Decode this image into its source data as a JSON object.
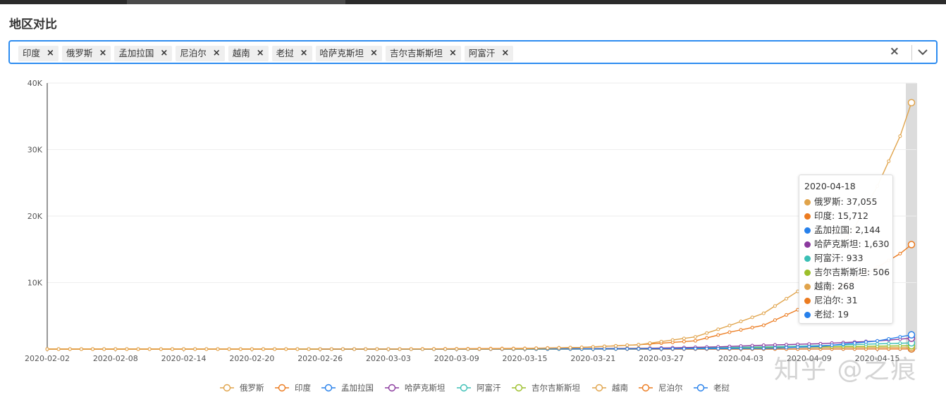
{
  "title": "地区对比",
  "selector": {
    "tags": [
      "印度",
      "俄罗斯",
      "孟加拉国",
      "尼泊尔",
      "越南",
      "老挝",
      "哈萨克斯坦",
      "吉尔吉斯斯坦",
      "阿富汗"
    ],
    "remove_glyph": "×",
    "clear_glyph": "×"
  },
  "tooltip": {
    "date": "2020-04-18",
    "rows": [
      {
        "label": "俄罗斯: 37,055",
        "color": "#e0a34a"
      },
      {
        "label": "印度: 15,712",
        "color": "#ec7b1f"
      },
      {
        "label": "孟加拉国: 2,144",
        "color": "#2680eb"
      },
      {
        "label": "哈萨克斯坦: 1,630",
        "color": "#8b3a9e"
      },
      {
        "label": "阿富汗: 933",
        "color": "#3bbfb5"
      },
      {
        "label": "吉尔吉斯斯坦: 506",
        "color": "#9cbf2a"
      },
      {
        "label": "越南: 268",
        "color": "#e0a34a"
      },
      {
        "label": "尼泊尔: 31",
        "color": "#ec7b1f"
      },
      {
        "label": "老挝: 19",
        "color": "#2680eb"
      }
    ]
  },
  "watermark": "知乎 @之痕",
  "chart_data": {
    "type": "line",
    "x_start": "2020-02-02",
    "x_end": "2020-04-18",
    "x_tick_labels": [
      "2020-02-02",
      "2020-02-08",
      "2020-02-14",
      "2020-02-20",
      "2020-02-26",
      "2020-03-03",
      "2020-03-09",
      "2020-03-15",
      "2020-03-21",
      "2020-03-27",
      "2020-04-03",
      "2020-04-09",
      "2020-04-15"
    ],
    "y_tick_labels": [
      "10K",
      "20K",
      "30K",
      "40K"
    ],
    "ylim": [
      0,
      40000
    ],
    "grid": true,
    "legend_position": "bottom",
    "highlighted_date": "2020-04-18",
    "series": [
      {
        "name": "俄罗斯",
        "color": "#e0a34a",
        "points": [
          [
            "2020-02-02",
            2
          ],
          [
            "2020-03-01",
            2
          ],
          [
            "2020-03-10",
            10
          ],
          [
            "2020-03-15",
            63
          ],
          [
            "2020-03-20",
            253
          ],
          [
            "2020-03-25",
            658
          ],
          [
            "2020-03-30",
            1836
          ],
          [
            "2020-04-02",
            3548
          ],
          [
            "2020-04-05",
            5389
          ],
          [
            "2020-04-08",
            8672
          ],
          [
            "2020-04-10",
            11917
          ],
          [
            "2020-04-13",
            18328
          ],
          [
            "2020-04-15",
            24490
          ],
          [
            "2020-04-17",
            32008
          ],
          [
            "2020-04-18",
            37055
          ]
        ]
      },
      {
        "name": "印度",
        "color": "#ec7b1f",
        "points": [
          [
            "2020-02-02",
            2
          ],
          [
            "2020-03-03",
            6
          ],
          [
            "2020-03-10",
            50
          ],
          [
            "2020-03-15",
            110
          ],
          [
            "2020-03-20",
            250
          ],
          [
            "2020-03-25",
            657
          ],
          [
            "2020-03-30",
            1251
          ],
          [
            "2020-04-02",
            2543
          ],
          [
            "2020-04-05",
            3588
          ],
          [
            "2020-04-08",
            5916
          ],
          [
            "2020-04-10",
            7598
          ],
          [
            "2020-04-13",
            10453
          ],
          [
            "2020-04-15",
            12322
          ],
          [
            "2020-04-17",
            14352
          ],
          [
            "2020-04-18",
            15712
          ]
        ]
      },
      {
        "name": "孟加拉国",
        "color": "#2680eb",
        "points": [
          [
            "2020-02-26",
            0
          ],
          [
            "2020-03-08",
            3
          ],
          [
            "2020-03-25",
            39
          ],
          [
            "2020-04-05",
            88
          ],
          [
            "2020-04-10",
            424
          ],
          [
            "2020-04-15",
            1231
          ],
          [
            "2020-04-18",
            2144
          ]
        ]
      },
      {
        "name": "哈萨克斯坦",
        "color": "#8b3a9e",
        "points": [
          [
            "2020-02-26",
            0
          ],
          [
            "2020-03-13",
            6
          ],
          [
            "2020-03-25",
            81
          ],
          [
            "2020-04-01",
            343
          ],
          [
            "2020-04-05",
            584
          ],
          [
            "2020-04-10",
            812
          ],
          [
            "2020-04-15",
            1232
          ],
          [
            "2020-04-18",
            1630
          ]
        ]
      },
      {
        "name": "阿富汗",
        "color": "#3bbfb5",
        "points": [
          [
            "2020-02-24",
            1
          ],
          [
            "2020-03-10",
            5
          ],
          [
            "2020-03-25",
            84
          ],
          [
            "2020-04-01",
            196
          ],
          [
            "2020-04-05",
            337
          ],
          [
            "2020-04-10",
            521
          ],
          [
            "2020-04-15",
            784
          ],
          [
            "2020-04-18",
            933
          ]
        ]
      },
      {
        "name": "吉尔吉斯斯坦",
        "color": "#9cbf2a",
        "points": [
          [
            "2020-02-26",
            0
          ],
          [
            "2020-03-18",
            3
          ],
          [
            "2020-03-25",
            44
          ],
          [
            "2020-04-01",
            111
          ],
          [
            "2020-04-05",
            216
          ],
          [
            "2020-04-10",
            339
          ],
          [
            "2020-04-15",
            449
          ],
          [
            "2020-04-18",
            506
          ]
        ]
      },
      {
        "name": "越南",
        "color": "#e0a34a",
        "points": [
          [
            "2020-02-02",
            8
          ],
          [
            "2020-02-15",
            16
          ],
          [
            "2020-03-06",
            16
          ],
          [
            "2020-03-15",
            53
          ],
          [
            "2020-03-25",
            141
          ],
          [
            "2020-04-05",
            241
          ],
          [
            "2020-04-10",
            257
          ],
          [
            "2020-04-18",
            268
          ]
        ]
      },
      {
        "name": "尼泊尔",
        "color": "#ec7b1f",
        "points": [
          [
            "2020-02-02",
            1
          ],
          [
            "2020-03-23",
            2
          ],
          [
            "2020-04-01",
            5
          ],
          [
            "2020-04-10",
            9
          ],
          [
            "2020-04-15",
            16
          ],
          [
            "2020-04-18",
            31
          ]
        ]
      },
      {
        "name": "老挝",
        "color": "#2680eb",
        "points": [
          [
            "2020-03-24",
            2
          ],
          [
            "2020-03-30",
            9
          ],
          [
            "2020-04-05",
            11
          ],
          [
            "2020-04-10",
            16
          ],
          [
            "2020-04-18",
            19
          ]
        ]
      }
    ]
  }
}
